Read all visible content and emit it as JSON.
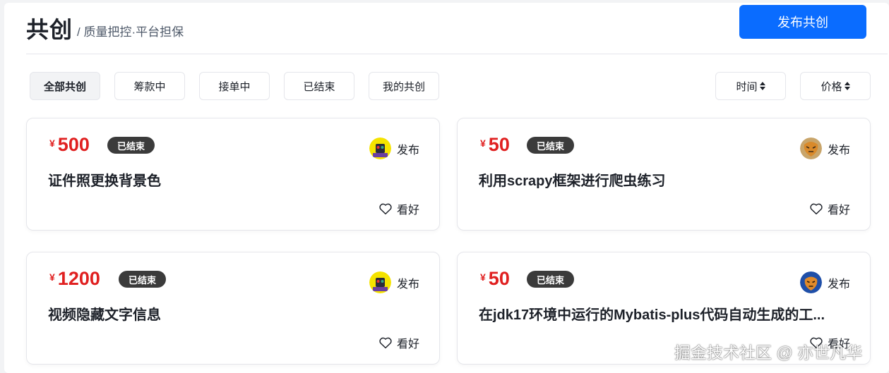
{
  "header": {
    "title": "共创",
    "subtitle": "/ 质量把控·平台担保",
    "publish_label": "发布共创"
  },
  "filters": [
    {
      "label": "全部共创",
      "active": true
    },
    {
      "label": "筹款中",
      "active": false
    },
    {
      "label": "接单中",
      "active": false
    },
    {
      "label": "已结束",
      "active": false
    },
    {
      "label": "我的共创",
      "active": false
    }
  ],
  "sorts": [
    {
      "label": "时间"
    },
    {
      "label": "价格"
    }
  ],
  "cards": [
    {
      "currency": "¥",
      "price": "500",
      "status": "已结束",
      "author_label": "发布",
      "title": "证件照更换背景色",
      "like_label": "看好",
      "avatar": "yellow-robot"
    },
    {
      "currency": "¥",
      "price": "50",
      "status": "已结束",
      "author_label": "发布",
      "title": "利用scrapy框架进行爬虫练习",
      "like_label": "看好",
      "avatar": "tiger"
    },
    {
      "currency": "¥",
      "price": "1200",
      "status": "已结束",
      "author_label": "发布",
      "title": "视频隐藏文字信息",
      "like_label": "看好",
      "avatar": "yellow-robot"
    },
    {
      "currency": "¥",
      "price": "50",
      "status": "已结束",
      "author_label": "发布",
      "title": "在jdk17环境中运行的Mybatis-plus代码自动生成的工...",
      "like_label": "看好",
      "avatar": "blue-tiger"
    }
  ],
  "watermark": "掘金技术社区 @ 亦世凡华",
  "colors": {
    "accent": "#0a6cff",
    "price": "#e02020",
    "badge": "#3b3b3b"
  }
}
